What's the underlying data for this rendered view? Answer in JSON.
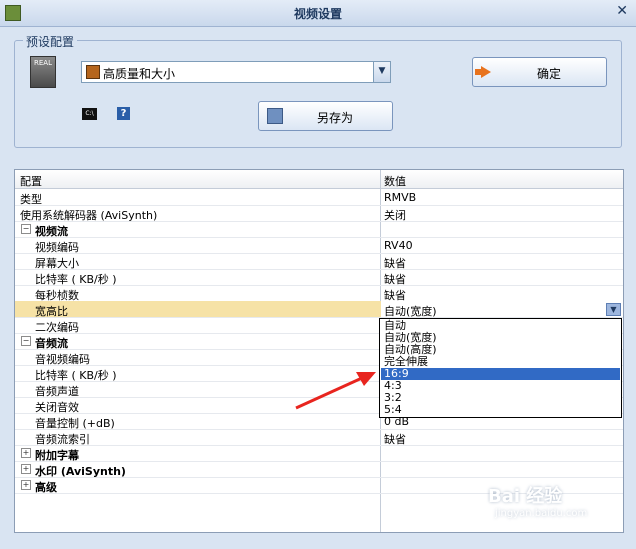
{
  "window": {
    "title": "视频设置",
    "close_glyph": "✕"
  },
  "preset": {
    "legend": "预设配置",
    "real_icon_text": "REAL",
    "select_value": "高质量和大小",
    "saveas_label": "另存为",
    "ok_label": "确定",
    "cmd_icon_text": "C:\\",
    "help_glyph": "?"
  },
  "grid": {
    "col_name": "配置",
    "col_value": "数值",
    "rows": [
      {
        "name": "类型",
        "value": "RMVB"
      },
      {
        "name": "使用系统解码器 (AviSynth)",
        "value": "关闭"
      },
      {
        "name": "视频流",
        "value": "",
        "toggle": "−"
      },
      {
        "name": "视频编码",
        "value": "RV40"
      },
      {
        "name": "屏幕大小",
        "value": "缺省"
      },
      {
        "name": "比特率 ( KB/秒 )",
        "value": "缺省"
      },
      {
        "name": "每秒桢数",
        "value": "缺省"
      },
      {
        "name": "宽高比",
        "value": "自动(宽度)"
      },
      {
        "name": "二次编码",
        "value": ""
      },
      {
        "name": "音频流",
        "value": "",
        "toggle": "−"
      },
      {
        "name": "音视频编码",
        "value": ""
      },
      {
        "name": "比特率 ( KB/秒 )",
        "value": ""
      },
      {
        "name": "音频声道",
        "value": ""
      },
      {
        "name": "关闭音效",
        "value": ""
      },
      {
        "name": "音量控制 (+dB)",
        "value": "0 dB"
      },
      {
        "name": "音频流索引",
        "value": "缺省"
      },
      {
        "name": "附加字幕",
        "value": "",
        "toggle": "+"
      },
      {
        "name": "水印 (AviSynth)",
        "value": "",
        "toggle": "+"
      },
      {
        "name": "高级",
        "value": "",
        "toggle": "+"
      }
    ]
  },
  "dropdown": {
    "options": [
      "自动",
      "自动(宽度)",
      "自动(高度)",
      "完全伸展",
      "16:9",
      "4:3",
      "3:2",
      "5:4"
    ],
    "selected": "16:9"
  },
  "watermark": {
    "text": "Bai 经验",
    "sub": "jingyan.baidu.com"
  },
  "colors": {
    "accent": "#316ac5",
    "selected_row": "#f6e2a6",
    "arrow": "#e8251f"
  }
}
